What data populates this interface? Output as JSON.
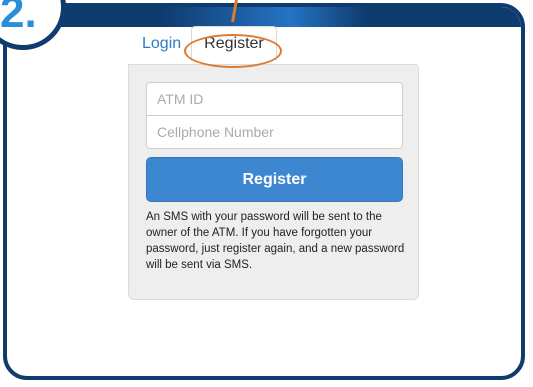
{
  "step": {
    "number": "2."
  },
  "tabs": {
    "login": "Login",
    "register": "Register"
  },
  "form": {
    "atm_id_placeholder": "ATM ID",
    "cellphone_placeholder": "Cellphone Number",
    "register_button": "Register",
    "info": "An SMS with your password will be sent to the owner of the ATM. If you have forgotten your password, just register again, and a new password will be sent via SMS."
  },
  "colors": {
    "frame": "#0f3b6e",
    "step_number": "#2a8fd8",
    "highlight": "#e07a2e",
    "button": "#3d87d1",
    "link": "#2d7bc7"
  }
}
